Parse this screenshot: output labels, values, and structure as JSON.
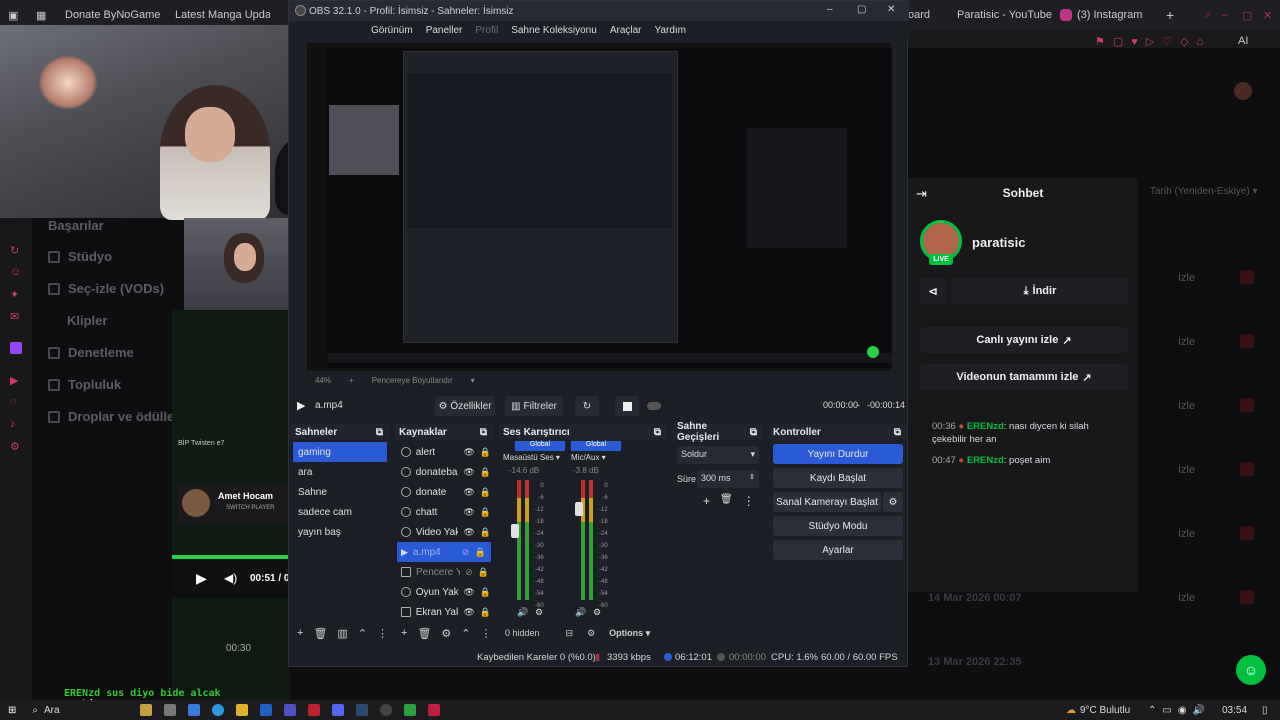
{
  "browser": {
    "tabs": [
      "Donate ByNoGame -",
      "Latest Manga Updat",
      "oard",
      "Paratisic - YouTube",
      "(3) Instagram"
    ]
  },
  "twitch": {
    "sidenav": [
      "Başarılar",
      "Stüdyo",
      "Seç-izle (VODs)",
      "Klipler",
      "Denetleme",
      "Topluluk",
      "Droplar ve ödüller"
    ],
    "sort_label": "Tarih (Yeniden-Eskiye)",
    "list_rows": [
      "İzle",
      "İzle",
      "İzle",
      "İzle",
      "İzle",
      "İzle"
    ],
    "list_dates": [
      "14 Mar 2026 00:07",
      "13 Mar 2026 22:35"
    ],
    "mini_player": {
      "game_tag": "BİP Twisten e7",
      "streamer": "Amet Hocam",
      "switch": "SWITCH PLAYER",
      "time": "00:51 / 0",
      "timer2": "00:30"
    },
    "overlay_line1": "ERENzd sus diyo bide alcak",
    "overlay_line2": "sanki"
  },
  "chat": {
    "title": "Sohbet",
    "channel": "paratisic",
    "live_badge": "LIVE",
    "download": "İndir",
    "watch_live": "Canlı yayını izle",
    "watch_full": "Videonun tamamını izle",
    "messages": [
      {
        "time": "00:36",
        "user": "ERENzd",
        "text": "nası diycen ki silah çekebilir her an"
      },
      {
        "time": "00:47",
        "user": "ERENzd",
        "text": "poşet aim"
      }
    ]
  },
  "obs": {
    "title": "OBS 32.1.0 - Profil: İsimsiz - Sahneler: İsimsiz",
    "menu": [
      "Görünüm",
      "Paneller",
      "Profil",
      "Sahne Koleksiyonu",
      "Araçlar",
      "Yardım"
    ],
    "zoom": "44%",
    "fit": "Pencereye Boyutlandır",
    "media": {
      "file": "a.mp4",
      "properties": "Özellikler",
      "filters": "Filtreler",
      "time": "00:00:00",
      "remaining": "-00:00:14"
    },
    "scenes": {
      "title": "Sahneler",
      "items": [
        "gaming",
        "ara",
        "Sahne",
        "sadece cam",
        "yayın baş"
      ],
      "selected": 0
    },
    "sources": {
      "title": "Kaynaklar",
      "items": [
        "alert",
        "donateba",
        "donate",
        "chatt",
        "Video Yak",
        "a.mp4",
        "Pencere Y",
        "Oyun Yak",
        "Ekran Yak"
      ]
    },
    "mixer": {
      "title": "Ses Karıştırıcı",
      "channels": [
        {
          "global": "Global",
          "name": "Masaüstü Ses",
          "db": "-14.6 dB"
        },
        {
          "global": "Global",
          "name": "Mic/Aux",
          "db": "-3.8 dB"
        }
      ],
      "ticks": [
        "0",
        "-6",
        "-12",
        "-18",
        "-24",
        "-30",
        "-36",
        "-42",
        "-48",
        "-54",
        "-60"
      ],
      "hidden": "0 hidden",
      "options": "Options"
    },
    "transitions": {
      "title": "Sahne Geçişleri",
      "type": "Soldur",
      "duration_label": "Süre",
      "duration": "300 ms"
    },
    "controls": {
      "title": "Kontroller",
      "buttons": [
        "Yayını Durdur",
        "Kaydı Başlat",
        "Sanal Kamerayı Başlat",
        "Stüdyo Modu",
        "Ayarlar"
      ]
    },
    "status": {
      "dropped": "Kaybedilen Kareler 0 (%0.0)",
      "bitrate": "3393 kbps",
      "stream_time": "06:12:01",
      "rec_time": "00:00:00",
      "cpu": "CPU: 1.6%",
      "fps": "60.00 / 60.00 FPS"
    }
  },
  "taskbar": {
    "search": "Ara",
    "weather": "9°C  Bulutlu",
    "clock": "03:54"
  },
  "colors": {
    "accent": "#2a5ad6",
    "twitch_purple": "#9147ff",
    "live_green": "#00c040"
  }
}
